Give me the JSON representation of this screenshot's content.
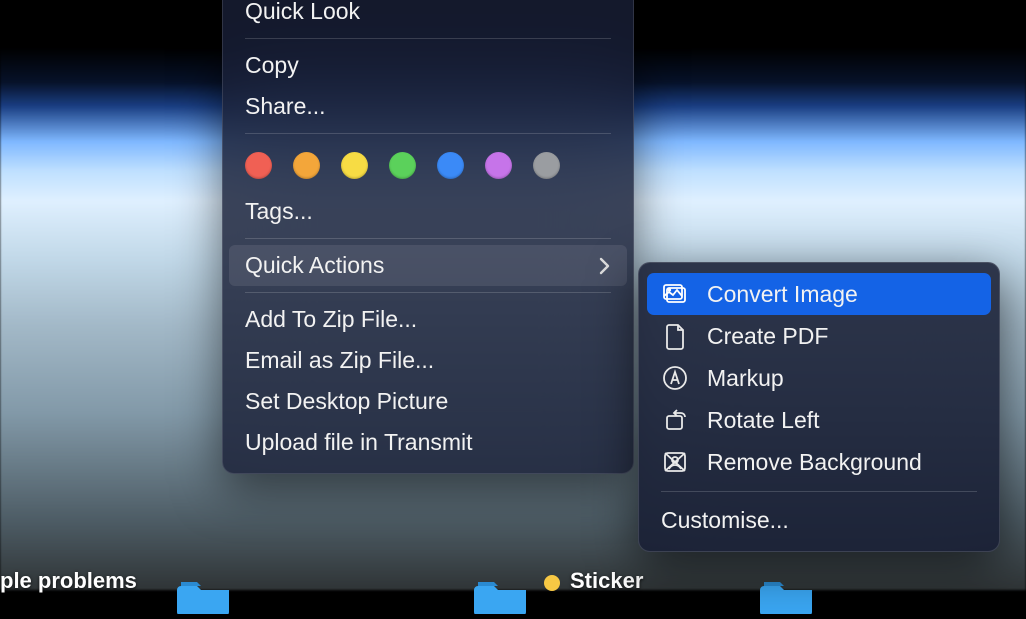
{
  "menu": {
    "quick_look": "Quick Look",
    "copy": "Copy",
    "share": "Share...",
    "tags_label": "Tags...",
    "quick_actions": "Quick Actions",
    "add_zip": "Add To Zip File...",
    "email_zip": "Email as Zip File...",
    "set_desktop": "Set Desktop Picture",
    "upload_transmit": "Upload file in Transmit",
    "tag_colors": [
      "#f06054",
      "#f3a63a",
      "#f7dc44",
      "#5bd15b",
      "#3b8af7",
      "#c674e9",
      "#9a9da1"
    ]
  },
  "submenu": {
    "convert_image": "Convert Image",
    "create_pdf": "Create PDF",
    "markup": "Markup",
    "rotate_left": "Rotate Left",
    "remove_bg": "Remove Background",
    "customise": "Customise..."
  },
  "desktop": {
    "label_left": "ple problems",
    "label_sticker": "Sticker"
  }
}
